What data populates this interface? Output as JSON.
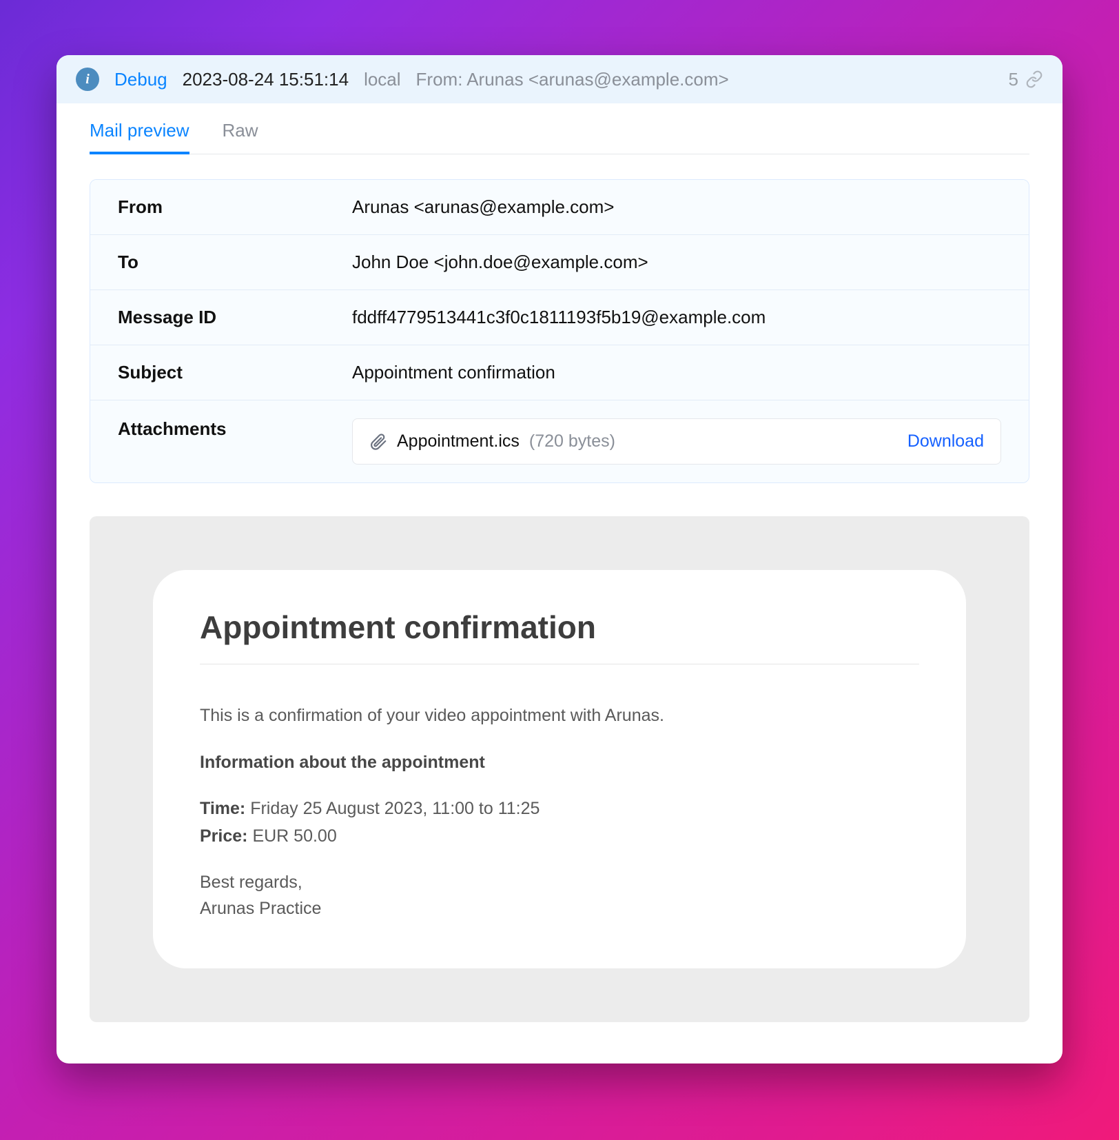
{
  "topbar": {
    "debug_label": "Debug",
    "timestamp": "2023-08-24 15:51:14",
    "scope": "local",
    "from_summary": "From: Arunas <arunas@example.com>",
    "count": "5"
  },
  "tabs": {
    "preview": "Mail preview",
    "raw": "Raw"
  },
  "meta": {
    "from_label": "From",
    "from_value": "Arunas <arunas@example.com>",
    "to_label": "To",
    "to_value": "John Doe <john.doe@example.com>",
    "msgid_label": "Message ID",
    "msgid_value": "fddff4779513441c3f0c1811193f5b19@example.com",
    "subject_label": "Subject",
    "subject_value": "Appointment confirmation",
    "attachments_label": "Attachments"
  },
  "attachment": {
    "name": "Appointment.ics",
    "size": "(720 bytes)",
    "download_label": "Download"
  },
  "email": {
    "title": "Appointment confirmation",
    "intro": "This is a confirmation of your video appointment with Arunas.",
    "info_heading": "Information about the appointment",
    "time_label": "Time:",
    "time_value": "Friday 25 August 2023, 11:00 to 11:25",
    "price_label": "Price:",
    "price_value": "EUR 50.00",
    "signoff1": "Best regards,",
    "signoff2": "Arunas Practice"
  }
}
